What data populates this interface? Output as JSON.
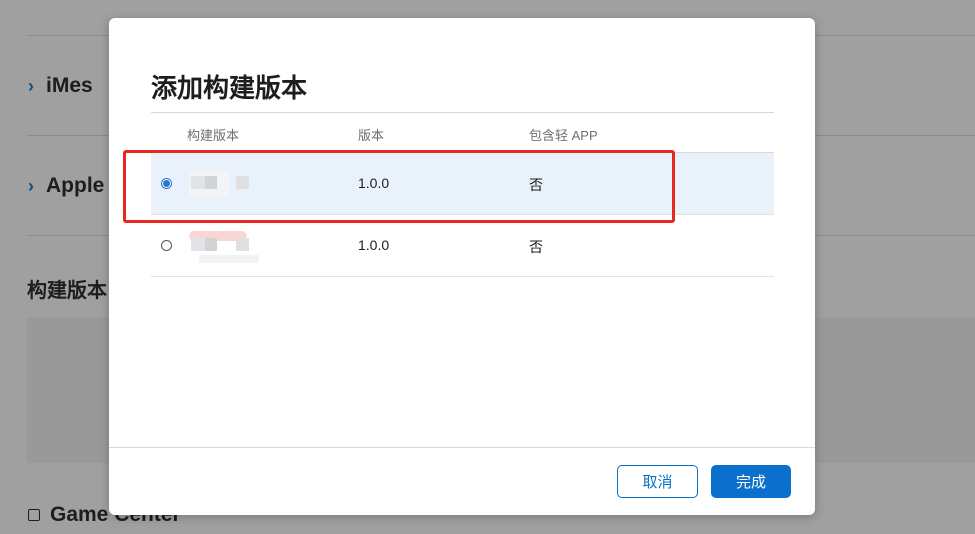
{
  "background": {
    "sections": [
      {
        "label": "iMes",
        "icon": "chevron-right-icon"
      },
      {
        "label": "Apple",
        "icon": "chevron-right-icon"
      }
    ],
    "builds_heading": "构建版本",
    "game_center_label": "Game Center"
  },
  "modal": {
    "title": "添加构建版本",
    "columns": {
      "build": "构建版本",
      "version": "版本",
      "lite_app": "包含轻 APP"
    },
    "rows": [
      {
        "version": "1.0.0",
        "lite_app": "否",
        "selected": true
      },
      {
        "version": "1.0.0",
        "lite_app": "否",
        "selected": false
      }
    ],
    "cancel_label": "取消",
    "done_label": "完成"
  },
  "colors": {
    "accent": "#0a70cc",
    "selected_row": "#e9f2fb",
    "highlight": "#e8281f"
  }
}
